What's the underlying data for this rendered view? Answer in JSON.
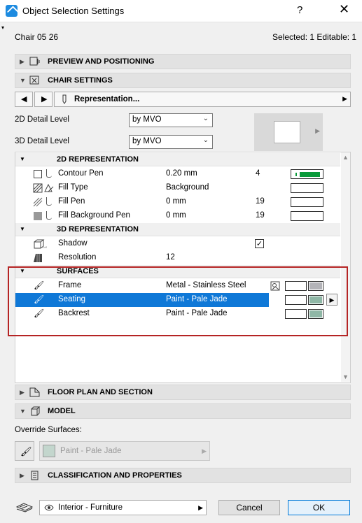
{
  "window": {
    "title": "Object Selection Settings",
    "help": "?",
    "close": "✕"
  },
  "header": {
    "object_name": "Chair 05 26",
    "selection_info": "Selected: 1 Editable: 1"
  },
  "sections": {
    "preview": "PREVIEW AND POSITIONING",
    "chair_settings": "CHAIR SETTINGS",
    "floor_plan": "FLOOR PLAN AND SECTION",
    "model": "MODEL",
    "classification": "CLASSIFICATION AND PROPERTIES"
  },
  "nav": {
    "prev": "◀",
    "next": "▶",
    "page_label": "Representation...",
    "page_arrow": "▶"
  },
  "detail": {
    "label_2d": "2D Detail Level",
    "value_2d": "by MVO",
    "label_3d": "3D Detail Level",
    "value_3d": "by MVO"
  },
  "table": {
    "group_2d": "2D REPRESENTATION",
    "rows_2d": [
      {
        "name": "Contour Pen",
        "value": "0.20 mm",
        "pen": "4"
      },
      {
        "name": "Fill Type",
        "value": "Background",
        "pen": ""
      },
      {
        "name": "Fill Pen",
        "value": "0 mm",
        "pen": "19"
      },
      {
        "name": "Fill Background Pen",
        "value": "0 mm",
        "pen": "19"
      }
    ],
    "group_3d": "3D REPRESENTATION",
    "rows_3d": [
      {
        "name": "Shadow",
        "value": "",
        "checked": "✓"
      },
      {
        "name": "Resolution",
        "value": "12"
      }
    ],
    "group_surfaces": "SURFACES",
    "rows_surfaces": [
      {
        "name": "Frame",
        "value": "Metal - Stainless Steel",
        "color": "#b3b3b8"
      },
      {
        "name": "Seating",
        "value": "Paint - Pale Jade",
        "color": "#8fb7a6"
      },
      {
        "name": "Backrest",
        "value": "Paint - Pale Jade",
        "color": "#8fb7a6"
      }
    ]
  },
  "override": {
    "label": "Override Surfaces:",
    "value": "Paint - Pale Jade",
    "color": "#c3d6cd"
  },
  "footer": {
    "layer": "Interior - Furniture",
    "cancel": "Cancel",
    "ok": "OK"
  },
  "colors": {
    "selection": "#0f78d7",
    "highlight": "#b52424",
    "contour_pen": "#0a9a3a"
  }
}
